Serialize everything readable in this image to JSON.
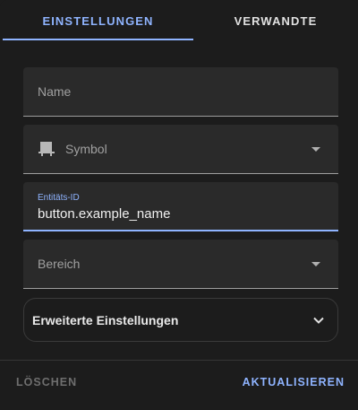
{
  "tabs": [
    {
      "label": "EINSTELLUNGEN",
      "active": true
    },
    {
      "label": "VERWANDTE",
      "active": false
    }
  ],
  "form": {
    "name_label": "Name",
    "icon_label": "Symbol",
    "icon_name": "icon-placeholder-icon",
    "entity_id_label": "Entitäts-ID",
    "entity_id_value": "button.example_name",
    "area_label": "Bereich",
    "advanced_label": "Erweiterte Einstellungen"
  },
  "footer": {
    "delete_label": "LÖSCHEN",
    "update_label": "AKTUALISIEREN"
  },
  "colors": {
    "accent": "#8fb4ff",
    "background": "#1c1c1c",
    "field_background": "#2a2a2a"
  }
}
